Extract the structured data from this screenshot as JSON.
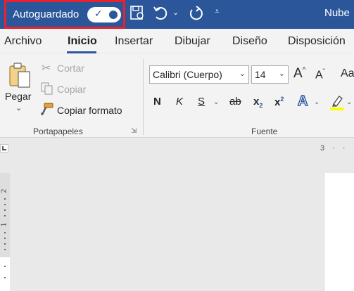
{
  "titlebar": {
    "autosave_label": "Autoguardado",
    "autosave_state": "on",
    "cloud_label": "Nube",
    "icons": [
      "save-sync-icon",
      "undo-icon",
      "redo-icon",
      "customize-qat-icon"
    ]
  },
  "tabs": [
    {
      "label": "Archivo"
    },
    {
      "label": "Inicio",
      "active": true
    },
    {
      "label": "Insertar"
    },
    {
      "label": "Dibujar"
    },
    {
      "label": "Diseño"
    },
    {
      "label": "Disposición"
    }
  ],
  "clipboard": {
    "paste_label": "Pegar",
    "cut_label": "Cortar",
    "copy_label": "Copiar",
    "format_painter_label": "Copiar formato",
    "group_label": "Portapapeles"
  },
  "font": {
    "font_name": "Calibri (Cuerpo)",
    "font_size": "14",
    "grow_label": "A",
    "shrink_label": "A",
    "case_label": "Aa",
    "bold_label": "N",
    "italic_label": "K",
    "underline_label": "S",
    "strike_label": "ab",
    "subscript_label": "x",
    "subscript_mark": "2",
    "superscript_label": "x",
    "superscript_mark": "2",
    "text_effects_label": "A",
    "group_label": "Fuente"
  },
  "ruler": {
    "top_text": "3 · · · ·",
    "left_numbers": [
      "2",
      "1"
    ]
  },
  "colors": {
    "title_bar": "#2b579a",
    "highlight_box": "#e8212e",
    "highlighter_yellow": "#ffff00"
  }
}
